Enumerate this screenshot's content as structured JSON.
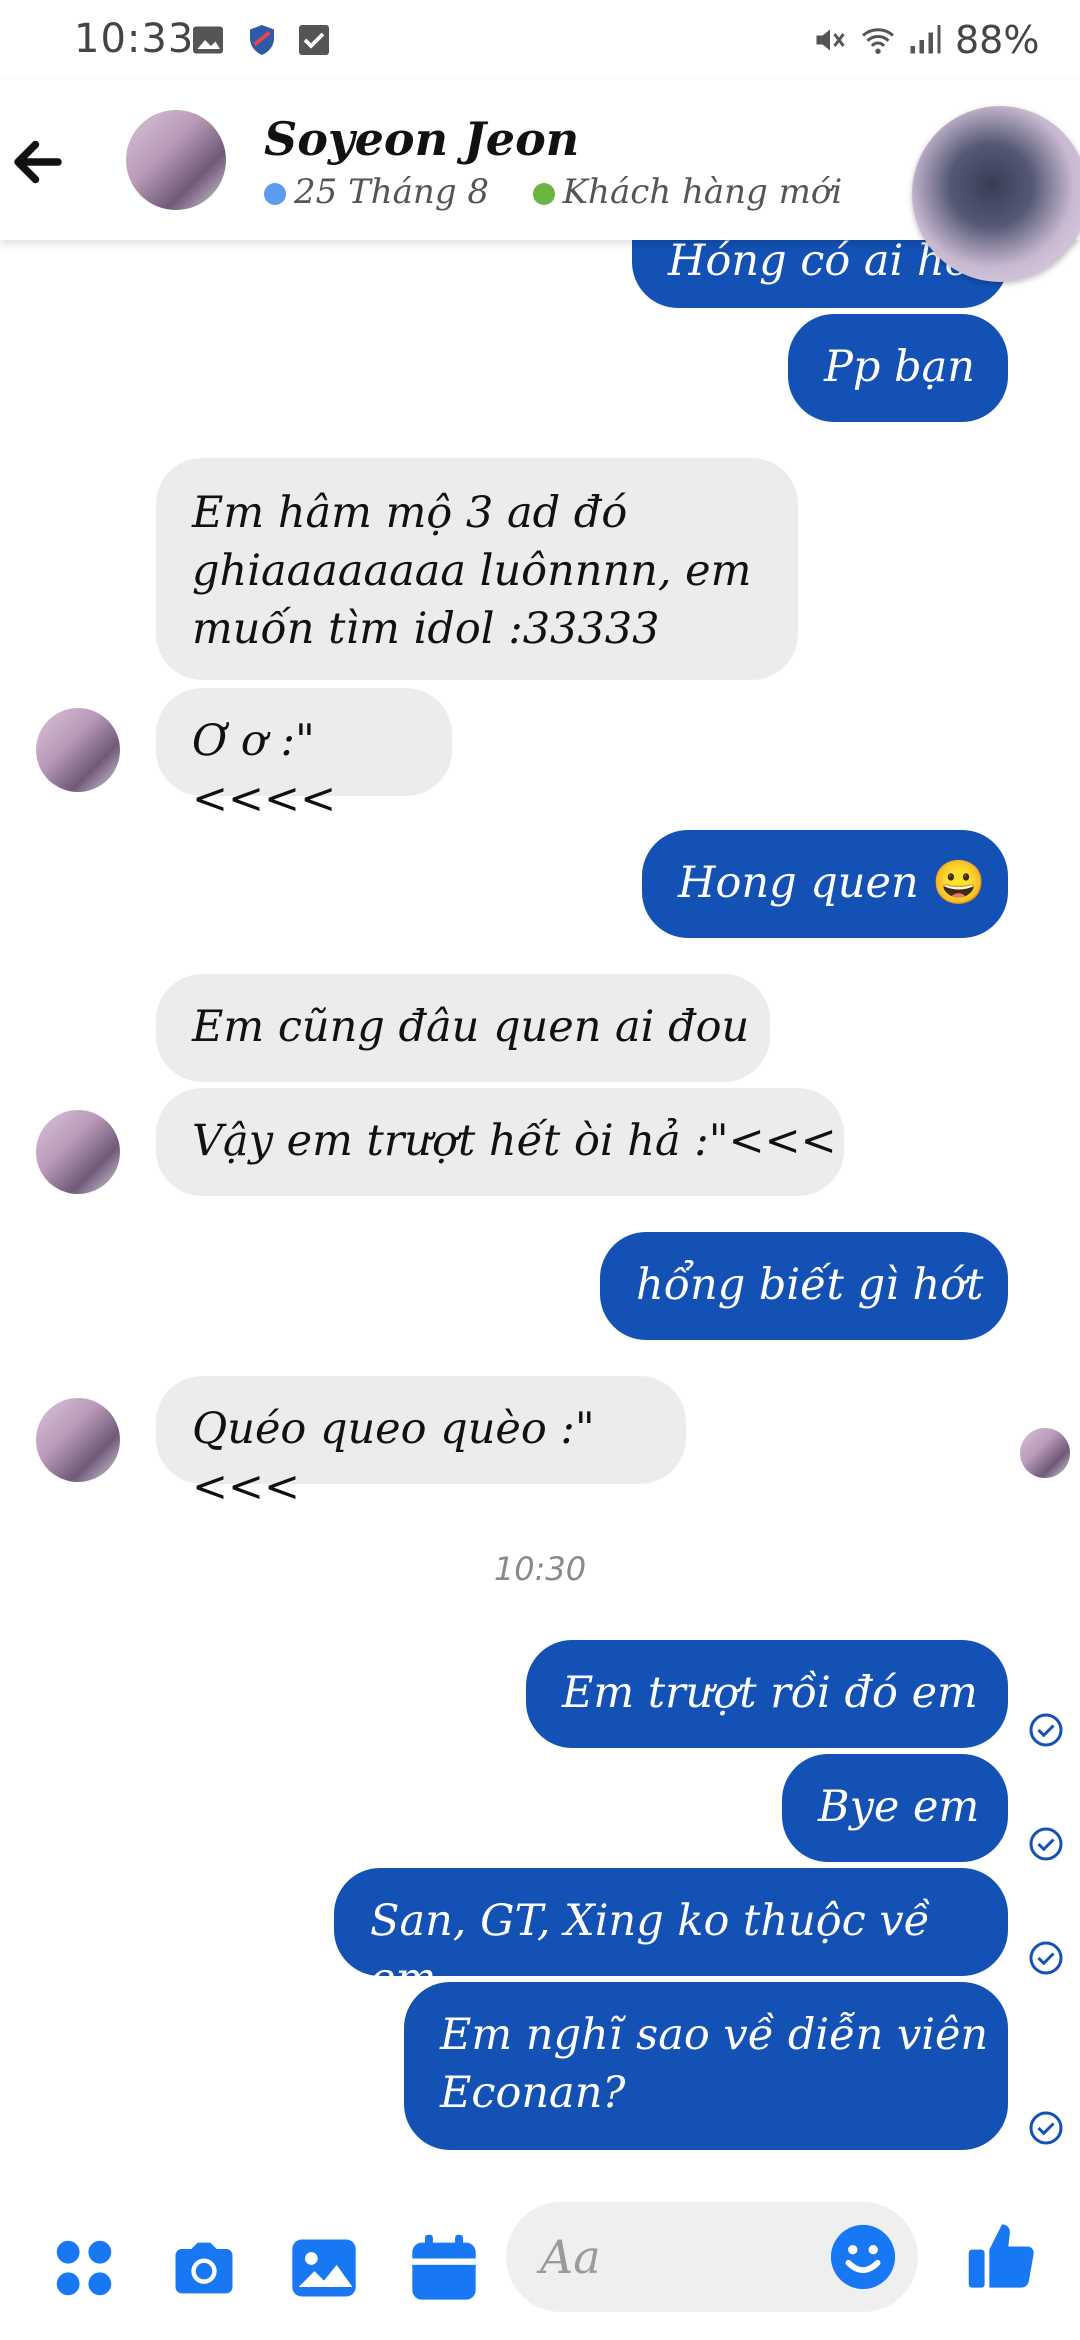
{
  "status_bar": {
    "time": "10:33",
    "battery": "88%"
  },
  "header": {
    "contact_name": "Soyeon Jeon",
    "date_label": "25 Tháng 8",
    "tag_label": "Khách hàng mới",
    "colors": {
      "date_dot": "#5b9bf0",
      "tag_dot": "#6db33f"
    }
  },
  "messages": [
    {
      "dir": "out",
      "text": "Hóng có ai hơ"
    },
    {
      "dir": "out",
      "text": "Pp bạn"
    },
    {
      "dir": "in",
      "lines": [
        "Em hâm mộ 3 ad đó",
        "ghiaaaaaaaa luônnnn, em",
        "muốn tìm idol :33333"
      ]
    },
    {
      "dir": "in",
      "text": "Ơ ơ :\"<<<<"
    },
    {
      "dir": "out",
      "text": "Hong quen",
      "emoji": "😀"
    },
    {
      "dir": "in",
      "text": "Em cũng đâu quen ai đou"
    },
    {
      "dir": "in",
      "text": "Vậy em trượt hết òi hả :\"<<<"
    },
    {
      "dir": "out",
      "text": "hổng biết gì hớt"
    },
    {
      "dir": "in",
      "text": "Quéo queo quèo :\"<<<"
    },
    {
      "dir": "out",
      "text": "Em trượt rồi đó em"
    },
    {
      "dir": "out",
      "text": "Bye em"
    },
    {
      "dir": "out",
      "text": "San, GT, Xing ko thuộc về em"
    },
    {
      "dir": "out",
      "lines": [
        "Em nghĩ sao về diễn viên",
        "Econan?"
      ]
    }
  ],
  "timestamp": "10:30",
  "composer": {
    "placeholder": "Aa"
  },
  "colors": {
    "accent": "#1351b4",
    "icon_blue": "#1877f2",
    "incoming_bg": "#ececec"
  }
}
